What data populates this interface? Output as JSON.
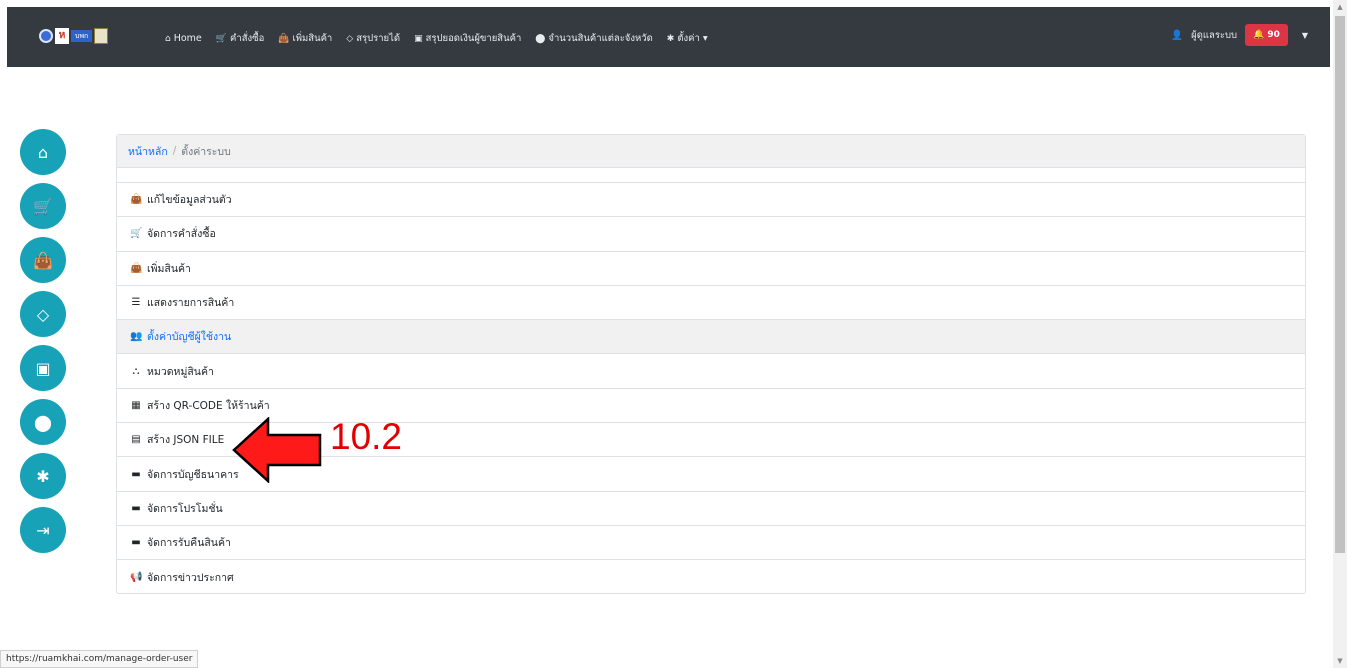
{
  "navbar": {
    "logo_text": "บพก",
    "menu": [
      {
        "icon": "home-icon",
        "glyph": "⌂",
        "label": "Home"
      },
      {
        "icon": "cart-icon",
        "glyph": "🛒",
        "label": "คำสั่งซื้อ"
      },
      {
        "icon": "bag-icon",
        "glyph": "👜",
        "label": "เพิ่มสินค้า"
      },
      {
        "icon": "gem-icon",
        "glyph": "◇",
        "label": "สรุปรายได้"
      },
      {
        "icon": "money-icon",
        "glyph": "▣",
        "label": "สรุปยอดเงินผู้ขายสินค้า"
      },
      {
        "icon": "location-icon",
        "glyph": "⬤",
        "label": "จำนวนสินค้าแต่ละจังหวัด"
      },
      {
        "icon": "gear-icon",
        "glyph": "✱",
        "label": "ตั้งค่า ▾"
      }
    ],
    "user_label": "ผู้ดูแลระบบ",
    "notification_count": "90"
  },
  "sidebar": [
    {
      "name": "home",
      "glyph": "⌂"
    },
    {
      "name": "cart",
      "glyph": "🛒"
    },
    {
      "name": "bag",
      "glyph": "👜"
    },
    {
      "name": "gem",
      "glyph": "◇"
    },
    {
      "name": "money",
      "glyph": "▣"
    },
    {
      "name": "location",
      "glyph": "⬤"
    },
    {
      "name": "gear",
      "glyph": "✱"
    },
    {
      "name": "logout",
      "glyph": "⇥"
    }
  ],
  "breadcrumb": {
    "home": "หน้าหลัก",
    "separator": "/",
    "current": "ตั้งค่าระบบ"
  },
  "settings_list": [
    {
      "icon": "bag-icon",
      "glyph": "👜",
      "label": "แก้ไขข้อมูลส่วนตัว",
      "active": false
    },
    {
      "icon": "cart-icon",
      "glyph": "🛒",
      "label": "จัดการคำสั่งซื้อ",
      "active": false
    },
    {
      "icon": "bag-icon",
      "glyph": "👜",
      "label": "เพิ่มสินค้า",
      "active": false
    },
    {
      "icon": "list-icon",
      "glyph": "☰",
      "label": "แสดงรายการสินค้า",
      "active": false
    },
    {
      "icon": "users-icon",
      "glyph": "👥",
      "label": "ตั้งค่าบัญชีผู้ใช้งาน",
      "active": true
    },
    {
      "icon": "sitemap-icon",
      "glyph": "⛬",
      "label": "หมวดหมู่สินค้า",
      "active": false
    },
    {
      "icon": "qrcode-icon",
      "glyph": "▦",
      "label": "สร้าง QR-CODE ให้ร้านค้า",
      "active": false
    },
    {
      "icon": "file-code-icon",
      "glyph": "▤",
      "label": "สร้าง JSON FILE",
      "active": false
    },
    {
      "icon": "id-card-icon",
      "glyph": "▬",
      "label": "จัดการบัญชีธนาคาร",
      "active": false
    },
    {
      "icon": "id-card-icon",
      "glyph": "▬",
      "label": "จัดการโปรโมชั่น",
      "active": false
    },
    {
      "icon": "id-card-icon",
      "glyph": "▬",
      "label": "จัดการรับคืนสินค้า",
      "active": false
    },
    {
      "icon": "megaphone-icon",
      "glyph": "📢",
      "label": "จัดการข่าวประกาศ",
      "active": false
    }
  ],
  "annotation": {
    "label": "10.2",
    "color": "#e00000"
  },
  "status_bar": {
    "url": "https://ruamkhai.com/manage-order-user"
  },
  "colors": {
    "navbar": "#343a40",
    "accent": "#17a2b8",
    "badge": "#dc3545",
    "link": "#0d6efd"
  }
}
